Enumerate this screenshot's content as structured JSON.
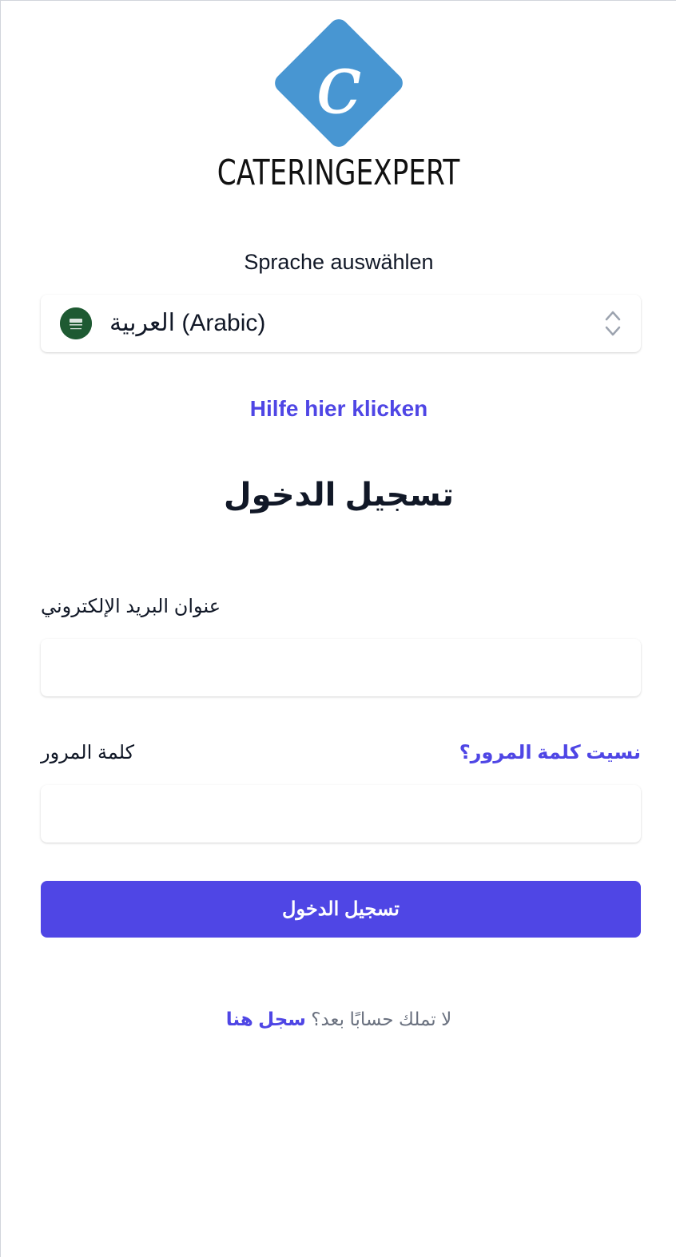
{
  "brand": {
    "logo_letter": "c",
    "name": "CATERINGEXPERT",
    "logo_color": "#4896d2"
  },
  "language": {
    "heading": "Sprache auswählen",
    "selected_value": "العربية (Arabic)",
    "flag": "saudi-arabia-flag-icon"
  },
  "help": {
    "link_text": "Hilfe hier klicken"
  },
  "login": {
    "title": "تسجيل الدخول",
    "email_label": "عنوان البريد الإلكتروني",
    "email_value": "",
    "password_label": "كلمة المرور",
    "password_value": "",
    "forgot_link": "نسيت كلمة المرور؟",
    "submit_label": "تسجيل الدخول",
    "register_prompt": "لا تملك حسابًا بعد؟",
    "register_link": "سجل هنا"
  },
  "colors": {
    "accent": "#4f46e5",
    "text": "#111827",
    "muted": "#6b7280"
  }
}
